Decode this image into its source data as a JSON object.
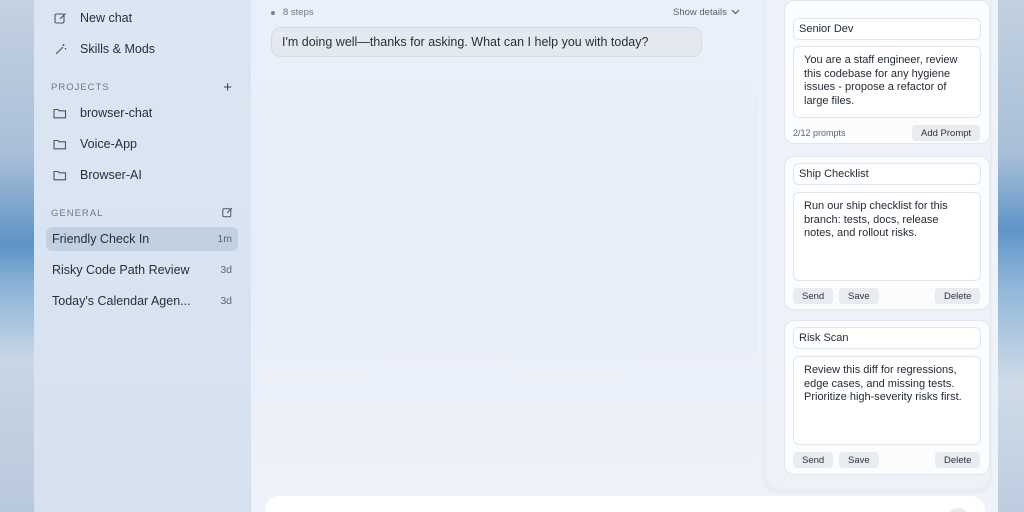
{
  "sidebar": {
    "top_items": [
      {
        "label": "New chat",
        "icon": "edit-icon"
      },
      {
        "label": "Skills & Mods",
        "icon": "wand-icon"
      }
    ],
    "projects_heading": "PROJECTS",
    "projects": [
      {
        "label": "browser-chat",
        "icon": "folder-icon"
      },
      {
        "label": "Voice-App",
        "icon": "folder-icon"
      },
      {
        "label": "Browser-AI",
        "icon": "folder-icon"
      }
    ],
    "general_heading": "GENERAL",
    "chats": [
      {
        "label": "Friendly Check In",
        "time": "1m",
        "active": true
      },
      {
        "label": "Risky Code Path Review",
        "time": "3d"
      },
      {
        "label": "Today's Calendar Agen...",
        "time": "3d"
      }
    ]
  },
  "main": {
    "steps_label": "8 steps",
    "show_details_label": "Show details",
    "assistant_message": "I'm doing well—thanks for asking. What can I help you with today?"
  },
  "prompts": {
    "cards": [
      {
        "title": "Senior Dev",
        "text": "You are a staff engineer, review this codebase for any hygiene issues - propose a refactor of large files.",
        "count_label": "2/12 prompts",
        "add_label": "Add Prompt"
      },
      {
        "title": "Ship Checklist",
        "text": "Run our ship checklist for this branch: tests, docs, release notes, and rollout risks.",
        "send_label": "Send",
        "save_label": "Save",
        "delete_label": "Delete"
      },
      {
        "title": "Risk Scan",
        "text": "Review this diff for regressions, edge cases, and missing tests. Prioritize high-severity risks first.",
        "send_label": "Send",
        "save_label": "Save",
        "delete_label": "Delete"
      }
    ]
  },
  "colors": {
    "active_row": "#c3d0e1",
    "sidebar_bg": "#d6e1f0",
    "bubble_bg": "#e3e9ef"
  }
}
